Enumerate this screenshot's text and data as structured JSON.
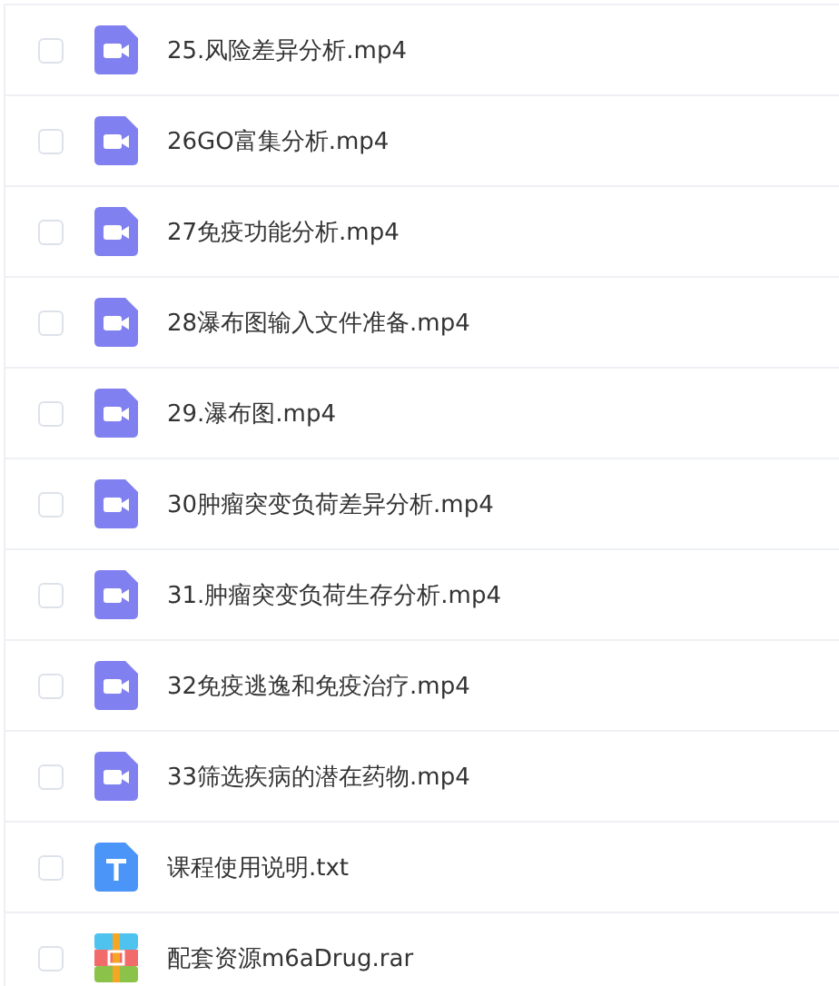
{
  "files": [
    {
      "name": "25.风险差异分析.mp4",
      "kind": "video",
      "checked": false
    },
    {
      "name": "26GO富集分析.mp4",
      "kind": "video",
      "checked": false
    },
    {
      "name": "27免疫功能分析.mp4",
      "kind": "video",
      "checked": false
    },
    {
      "name": "28瀑布图输入文件准备.mp4",
      "kind": "video",
      "checked": false
    },
    {
      "name": "29.瀑布图.mp4",
      "kind": "video",
      "checked": false
    },
    {
      "name": "30肿瘤突变负荷差异分析.mp4",
      "kind": "video",
      "checked": false
    },
    {
      "name": "31.肿瘤突变负荷生存分析.mp4",
      "kind": "video",
      "checked": false
    },
    {
      "name": "32免疫逃逸和免疫治疗.mp4",
      "kind": "video",
      "checked": false
    },
    {
      "name": "33筛选疾病的潜在药物.mp4",
      "kind": "video",
      "checked": false
    },
    {
      "name": "课程使用说明.txt",
      "kind": "text",
      "checked": false
    },
    {
      "name": "配套资源m6aDrug.rar",
      "kind": "archive",
      "checked": false
    }
  ]
}
